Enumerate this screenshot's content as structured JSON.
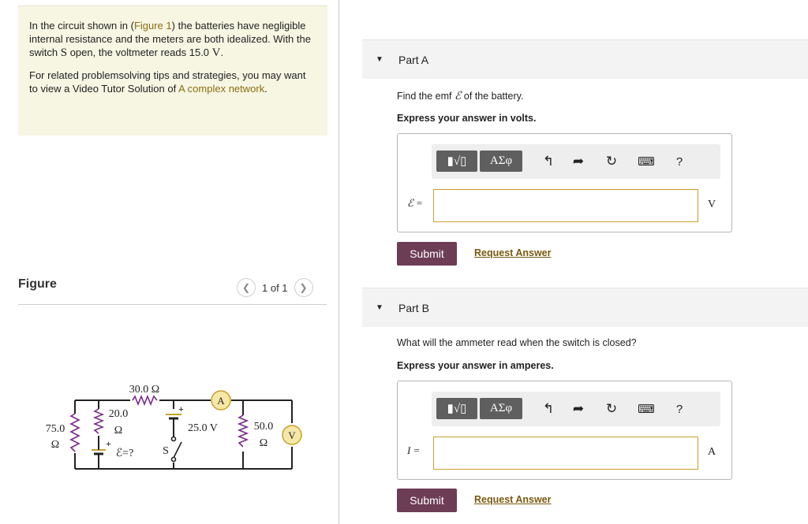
{
  "problem": {
    "para1_pre": "In the circuit shown in (",
    "para1_link": "Figure 1",
    "para1_mid": ") the batteries have negligible internal resistance and the meters are both idealized. With the switch ",
    "switch_symbol": "S",
    "para1_mid2": " open, the voltmeter reads ",
    "voltage_value": "15.0",
    "voltage_unit": "V",
    "para1_end": ".",
    "para2_pre": "For related problemsolving tips and strategies, you may want to view a Video Tutor Solution of ",
    "para2_link": "A complex network",
    "para2_end": "."
  },
  "figure": {
    "title": "Figure",
    "pager_text": "1 of 1",
    "prev_icon": "chevron-left-icon",
    "next_icon": "chevron-right-icon"
  },
  "circuit": {
    "r_top": "30.0 Ω",
    "r_left_a": "75.0",
    "r_left_b": "Ω",
    "r_mid_a": "20.0",
    "r_mid_b": "Ω",
    "emf_label": "ℰ=?",
    "plus": "+",
    "battery_v": "25.0 V",
    "switch": "S",
    "r_right_a": "50.0",
    "r_right_b": "Ω",
    "ammeter": "A",
    "voltmeter": "V"
  },
  "toolbar": {
    "templates_label": "▮√▯",
    "greek_label": "ΑΣφ",
    "undo_icon": "undo-icon",
    "redo_icon": "redo-icon",
    "reset_icon": "reset-icon",
    "keyboard_icon": "keyboard-icon",
    "help_label": "?"
  },
  "partA": {
    "label": "Part A",
    "question_pre": "Find the emf ",
    "question_symbol": "ℰ",
    "question_post": " of the battery.",
    "instruction": "Express your answer in volts.",
    "var": "ℰ =",
    "input_value": "",
    "unit": "V",
    "submit": "Submit",
    "request": "Request Answer"
  },
  "partB": {
    "label": "Part B",
    "question": "What will the ammeter read when the switch is closed?",
    "instruction": "Express your answer in amperes.",
    "var": "I =",
    "input_value": "",
    "unit": "A",
    "submit": "Submit",
    "request": "Request Answer"
  },
  "colors": {
    "submit_bg": "#6d3c55",
    "link": "#8c6d10",
    "input_border": "#c9a12b",
    "resistor": "#7a2a8a",
    "meter_fill": "#f5e7a8",
    "meter_stroke": "#c9a12b"
  }
}
